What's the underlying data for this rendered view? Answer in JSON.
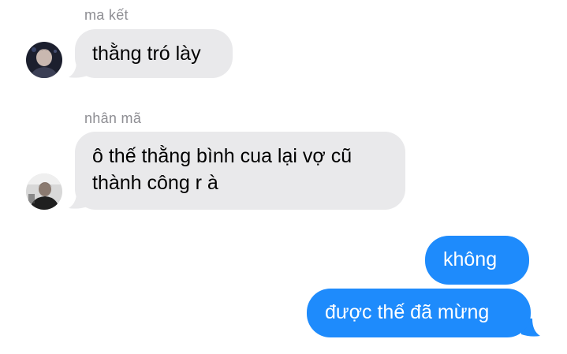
{
  "colors": {
    "incoming_bubble": "#e9e9eb",
    "outgoing_bubble": "#1e8bfc",
    "sender_name": "#8e8e93"
  },
  "messages": [
    {
      "sender": "ma kết",
      "avatar": "user-avatar-photo",
      "direction": "incoming",
      "lines": [
        "thằng tró lày"
      ]
    },
    {
      "sender": "nhân mã",
      "avatar": "user-avatar-photo",
      "direction": "incoming",
      "lines": [
        "ô thế thằng bình cua lại vợ cũ",
        "thành công r à"
      ]
    },
    {
      "direction": "outgoing",
      "lines": [
        "không"
      ]
    },
    {
      "direction": "outgoing",
      "lines": [
        "được thế đã mừng"
      ]
    }
  ]
}
